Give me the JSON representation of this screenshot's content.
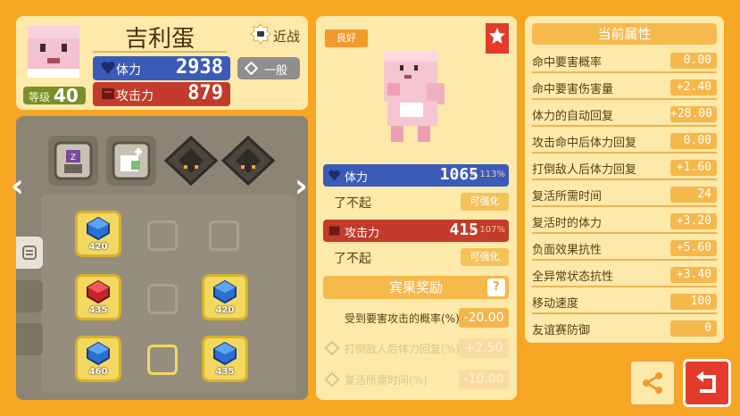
{
  "header": {
    "name": "吉利蛋",
    "level_label": "等级",
    "level": "40",
    "range_label": "近战",
    "hp_label": "体力",
    "hp_value": "2938",
    "atk_label": "攻击力",
    "atk_value": "879",
    "type_label": "一般"
  },
  "grid": {
    "tiles": [
      {
        "value": "420",
        "kind": "hp"
      },
      {
        "value": "435",
        "kind": "atk"
      },
      {
        "value": "420",
        "kind": "hp"
      },
      {
        "value": "460",
        "kind": "hp"
      },
      {
        "value": "435",
        "kind": "hp"
      }
    ]
  },
  "center": {
    "quality_tag": "良好",
    "hp_label": "体力",
    "hp_value": "1065",
    "hp_pct": "× 113%",
    "hp_rating": "了不起",
    "hp_upgrade": "可强化",
    "atk_label": "攻击力",
    "atk_value": "415",
    "atk_pct": "× 107%",
    "atk_rating": "了不起",
    "atk_upgrade": "可强化",
    "bonus_title": "宾果奖励",
    "bonus_rows": [
      {
        "label": "受到要害攻击的概率(%)",
        "value": "-20.00"
      },
      {
        "label": "打倒敌人后体力回复(%)",
        "value": "+2.50"
      },
      {
        "label": "复活所需时间(%)",
        "value": "-10.00"
      }
    ]
  },
  "attributes": {
    "title": "当前属性",
    "rows": [
      {
        "label": "命中要害概率",
        "value": "0.00"
      },
      {
        "label": "命中要害伤害量",
        "value": "+2.40"
      },
      {
        "label": "体力的自动回复",
        "value": "+28.00"
      },
      {
        "label": "攻击命中后体力回复",
        "value": "0.00"
      },
      {
        "label": "打倒敌人后体力回复",
        "value": "+1.60"
      },
      {
        "label": "复活所需时间",
        "value": "24"
      },
      {
        "label": "复活时的体力",
        "value": "+3.20"
      },
      {
        "label": "负面效果抗性",
        "value": "+5.60"
      },
      {
        "label": "全异常状态抗性",
        "value": "+3.40"
      },
      {
        "label": "移动速度",
        "value": "100"
      },
      {
        "label": "友谊赛防御",
        "value": "0"
      }
    ]
  },
  "colors": {
    "background": "#f6a623",
    "panel": "#fde9a9",
    "hp": "#3a5bb8",
    "atk": "#c23b2b",
    "accent": "#f6b94b"
  }
}
